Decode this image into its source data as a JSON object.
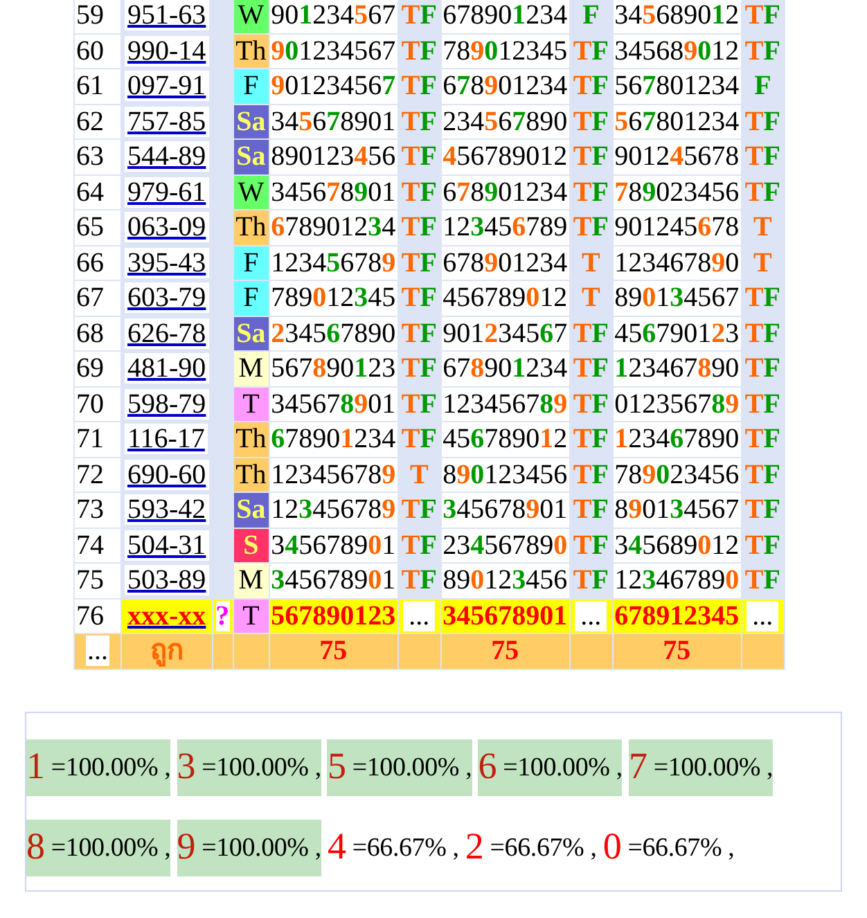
{
  "rows": [
    {
      "no": "59",
      "code": "951-63",
      "day": {
        "text": "W",
        "color": "#66ff66"
      },
      "cells": [
        {
          "kind": "number",
          "parts": [
            {
              "text": "90"
            },
            {
              "text": "1",
              "color": "#009900"
            },
            {
              "text": "234"
            },
            {
              "text": "5",
              "color": "#ff6600"
            },
            {
              "text": "67"
            }
          ]
        },
        {
          "kind": "result",
          "parts": [
            {
              "text": "T",
              "color": "#ff6600"
            },
            {
              "text": "F",
              "color": "#009900"
            }
          ]
        },
        {
          "kind": "number",
          "parts": [
            {
              "text": "67890"
            },
            {
              "text": "1",
              "color": "#009900"
            },
            {
              "text": "234"
            }
          ]
        },
        {
          "kind": "result",
          "parts": [
            {
              "text": "F",
              "color": "#009900"
            }
          ]
        },
        {
          "kind": "number",
          "parts": [
            {
              "text": "34"
            },
            {
              "text": "5",
              "color": "#ff6600"
            },
            {
              "text": "6890"
            },
            {
              "text": "1",
              "color": "#009900"
            },
            {
              "text": "2"
            }
          ]
        },
        {
          "kind": "result",
          "parts": [
            {
              "text": "T",
              "color": "#ff6600"
            },
            {
              "text": "F",
              "color": "#009900"
            }
          ]
        }
      ]
    },
    {
      "no": "60",
      "code": "990-14",
      "day": {
        "text": "Th",
        "color": "#ffcc66"
      },
      "cells": [
        {
          "kind": "number",
          "parts": [
            {
              "text": "9",
              "color": "#ff6600"
            },
            {
              "text": "0",
              "color": "#009900"
            },
            {
              "text": "1234567"
            }
          ]
        },
        {
          "kind": "result",
          "parts": [
            {
              "text": "T",
              "color": "#ff6600"
            },
            {
              "text": "F",
              "color": "#009900"
            }
          ]
        },
        {
          "kind": "number",
          "parts": [
            {
              "text": "78"
            },
            {
              "text": "9",
              "color": "#ff6600"
            },
            {
              "text": "0",
              "color": "#009900"
            },
            {
              "text": "12345"
            }
          ]
        },
        {
          "kind": "result",
          "parts": [
            {
              "text": "T",
              "color": "#ff6600"
            },
            {
              "text": "F",
              "color": "#009900"
            }
          ]
        },
        {
          "kind": "number",
          "parts": [
            {
              "text": "34568"
            },
            {
              "text": "9",
              "color": "#ff6600"
            },
            {
              "text": "0",
              "color": "#009900"
            },
            {
              "text": "12"
            }
          ]
        },
        {
          "kind": "result",
          "parts": [
            {
              "text": "T",
              "color": "#ff6600"
            },
            {
              "text": "F",
              "color": "#009900"
            }
          ]
        }
      ]
    },
    {
      "no": "61",
      "code": "097-91",
      "day": {
        "text": "F",
        "color": "#66ffff"
      },
      "cells": [
        {
          "kind": "number",
          "parts": [
            {
              "text": "9",
              "color": "#ff6600"
            },
            {
              "text": "0123456"
            },
            {
              "text": "7",
              "color": "#009900"
            }
          ]
        },
        {
          "kind": "result",
          "parts": [
            {
              "text": "T",
              "color": "#ff6600"
            },
            {
              "text": "F",
              "color": "#009900"
            }
          ]
        },
        {
          "kind": "number",
          "parts": [
            {
              "text": "6"
            },
            {
              "text": "7",
              "color": "#009900"
            },
            {
              "text": "8"
            },
            {
              "text": "9",
              "color": "#ff6600"
            },
            {
              "text": "01234"
            }
          ]
        },
        {
          "kind": "result",
          "parts": [
            {
              "text": "T",
              "color": "#ff6600"
            },
            {
              "text": "F",
              "color": "#009900"
            }
          ]
        },
        {
          "kind": "number",
          "parts": [
            {
              "text": "56"
            },
            {
              "text": "7",
              "color": "#009900"
            },
            {
              "text": "801234"
            }
          ]
        },
        {
          "kind": "result",
          "parts": [
            {
              "text": "F",
              "color": "#009900"
            }
          ]
        }
      ]
    },
    {
      "no": "62",
      "code": "757-85",
      "day": {
        "text": "Sa",
        "color": "#6666cc"
      },
      "cells": [
        {
          "kind": "number",
          "parts": [
            {
              "text": "34"
            },
            {
              "text": "5",
              "color": "#ff6600"
            },
            {
              "text": "6"
            },
            {
              "text": "7",
              "color": "#009900"
            },
            {
              "text": "8901"
            }
          ]
        },
        {
          "kind": "result",
          "parts": [
            {
              "text": "T",
              "color": "#ff6600"
            },
            {
              "text": "F",
              "color": "#009900"
            }
          ]
        },
        {
          "kind": "number",
          "parts": [
            {
              "text": "234"
            },
            {
              "text": "5",
              "color": "#ff6600"
            },
            {
              "text": "6"
            },
            {
              "text": "7",
              "color": "#009900"
            },
            {
              "text": "890"
            }
          ]
        },
        {
          "kind": "result",
          "parts": [
            {
              "text": "T",
              "color": "#ff6600"
            },
            {
              "text": "F",
              "color": "#009900"
            }
          ]
        },
        {
          "kind": "number",
          "parts": [
            {
              "text": "5",
              "color": "#ff6600"
            },
            {
              "text": "6"
            },
            {
              "text": "7",
              "color": "#009900"
            },
            {
              "text": "801234"
            }
          ]
        },
        {
          "kind": "result",
          "parts": [
            {
              "text": "T",
              "color": "#ff6600"
            },
            {
              "text": "F",
              "color": "#009900"
            }
          ]
        }
      ]
    },
    {
      "no": "63",
      "code": "544-89",
      "day": {
        "text": "Sa",
        "color": "#6666cc"
      },
      "cells": [
        {
          "kind": "number",
          "parts": [
            {
              "text": "890123"
            },
            {
              "text": "4",
              "color": "#ff6600"
            },
            {
              "text": "56"
            }
          ]
        },
        {
          "kind": "result",
          "parts": [
            {
              "text": "T",
              "color": "#ff6600"
            },
            {
              "text": "F",
              "color": "#009900"
            }
          ]
        },
        {
          "kind": "number",
          "parts": [
            {
              "text": "4",
              "color": "#ff6600"
            },
            {
              "text": "56789012"
            }
          ]
        },
        {
          "kind": "result",
          "parts": [
            {
              "text": "T",
              "color": "#ff6600"
            },
            {
              "text": "F",
              "color": "#009900"
            }
          ]
        },
        {
          "kind": "number",
          "parts": [
            {
              "text": "9012"
            },
            {
              "text": "4",
              "color": "#ff6600"
            },
            {
              "text": "5678"
            }
          ]
        },
        {
          "kind": "result",
          "parts": [
            {
              "text": "T",
              "color": "#ff6600"
            },
            {
              "text": "F",
              "color": "#009900"
            }
          ]
        }
      ]
    },
    {
      "no": "64",
      "code": "979-61",
      "day": {
        "text": "W",
        "color": "#66ff66"
      },
      "cells": [
        {
          "kind": "number",
          "parts": [
            {
              "text": "3456"
            },
            {
              "text": "7",
              "color": "#ff6600"
            },
            {
              "text": "8"
            },
            {
              "text": "9",
              "color": "#009900"
            },
            {
              "text": "01"
            }
          ]
        },
        {
          "kind": "result",
          "parts": [
            {
              "text": "T",
              "color": "#ff6600"
            },
            {
              "text": "F",
              "color": "#009900"
            }
          ]
        },
        {
          "kind": "number",
          "parts": [
            {
              "text": "6"
            },
            {
              "text": "7",
              "color": "#ff6600"
            },
            {
              "text": "8"
            },
            {
              "text": "9",
              "color": "#009900"
            },
            {
              "text": "01234"
            }
          ]
        },
        {
          "kind": "result",
          "parts": [
            {
              "text": "T",
              "color": "#ff6600"
            },
            {
              "text": "F",
              "color": "#009900"
            }
          ]
        },
        {
          "kind": "number",
          "parts": [
            {
              "text": "7",
              "color": "#ff6600"
            },
            {
              "text": "8"
            },
            {
              "text": "9",
              "color": "#009900"
            },
            {
              "text": "023456"
            }
          ]
        },
        {
          "kind": "result",
          "parts": [
            {
              "text": "T",
              "color": "#ff6600"
            },
            {
              "text": "F",
              "color": "#009900"
            }
          ]
        }
      ]
    },
    {
      "no": "65",
      "code": "063-09",
      "day": {
        "text": "Th",
        "color": "#ffcc66"
      },
      "cells": [
        {
          "kind": "number",
          "parts": [
            {
              "text": "6",
              "color": "#ff6600"
            },
            {
              "text": "789012"
            },
            {
              "text": "3",
              "color": "#009900"
            },
            {
              "text": "4"
            }
          ]
        },
        {
          "kind": "result",
          "parts": [
            {
              "text": "T",
              "color": "#ff6600"
            },
            {
              "text": "F",
              "color": "#009900"
            }
          ]
        },
        {
          "kind": "number",
          "parts": [
            {
              "text": "12"
            },
            {
              "text": "3",
              "color": "#009900"
            },
            {
              "text": "45"
            },
            {
              "text": "6",
              "color": "#ff6600"
            },
            {
              "text": "789"
            }
          ]
        },
        {
          "kind": "result",
          "parts": [
            {
              "text": "T",
              "color": "#ff6600"
            },
            {
              "text": "F",
              "color": "#009900"
            }
          ]
        },
        {
          "kind": "number",
          "parts": [
            {
              "text": "901245"
            },
            {
              "text": "6",
              "color": "#ff6600"
            },
            {
              "text": "78"
            }
          ]
        },
        {
          "kind": "result",
          "parts": [
            {
              "text": "T",
              "color": "#ff6600"
            }
          ]
        }
      ]
    },
    {
      "no": "66",
      "code": "395-43",
      "day": {
        "text": "F",
        "color": "#66ffff"
      },
      "cells": [
        {
          "kind": "number",
          "parts": [
            {
              "text": "1234"
            },
            {
              "text": "5",
              "color": "#009900"
            },
            {
              "text": "678"
            },
            {
              "text": "9",
              "color": "#ff6600"
            }
          ]
        },
        {
          "kind": "result",
          "parts": [
            {
              "text": "T",
              "color": "#ff6600"
            },
            {
              "text": "F",
              "color": "#009900"
            }
          ]
        },
        {
          "kind": "number",
          "parts": [
            {
              "text": "678"
            },
            {
              "text": "9",
              "color": "#ff6600"
            },
            {
              "text": "01234"
            }
          ]
        },
        {
          "kind": "result",
          "parts": [
            {
              "text": "T",
              "color": "#ff6600"
            }
          ]
        },
        {
          "kind": "number",
          "parts": [
            {
              "text": "1234678"
            },
            {
              "text": "9",
              "color": "#ff6600"
            },
            {
              "text": "0"
            }
          ]
        },
        {
          "kind": "result",
          "parts": [
            {
              "text": "T",
              "color": "#ff6600"
            }
          ]
        }
      ]
    },
    {
      "no": "67",
      "code": "603-79",
      "day": {
        "text": "F",
        "color": "#66ffff"
      },
      "cells": [
        {
          "kind": "number",
          "parts": [
            {
              "text": "789"
            },
            {
              "text": "0",
              "color": "#ff6600"
            },
            {
              "text": "12"
            },
            {
              "text": "3",
              "color": "#009900"
            },
            {
              "text": "45"
            }
          ]
        },
        {
          "kind": "result",
          "parts": [
            {
              "text": "T",
              "color": "#ff6600"
            },
            {
              "text": "F",
              "color": "#009900"
            }
          ]
        },
        {
          "kind": "number",
          "parts": [
            {
              "text": "456789"
            },
            {
              "text": "0",
              "color": "#ff6600"
            },
            {
              "text": "12"
            }
          ]
        },
        {
          "kind": "result",
          "parts": [
            {
              "text": "T",
              "color": "#ff6600"
            }
          ]
        },
        {
          "kind": "number",
          "parts": [
            {
              "text": "89"
            },
            {
              "text": "0",
              "color": "#ff6600"
            },
            {
              "text": "1"
            },
            {
              "text": "3",
              "color": "#009900"
            },
            {
              "text": "4567"
            }
          ]
        },
        {
          "kind": "result",
          "parts": [
            {
              "text": "T",
              "color": "#ff6600"
            },
            {
              "text": "F",
              "color": "#009900"
            }
          ]
        }
      ]
    },
    {
      "no": "68",
      "code": "626-78",
      "day": {
        "text": "Sa",
        "color": "#6666cc"
      },
      "cells": [
        {
          "kind": "number",
          "parts": [
            {
              "text": "2",
              "color": "#ff6600"
            },
            {
              "text": "345"
            },
            {
              "text": "6",
              "color": "#009900"
            },
            {
              "text": "7890"
            }
          ]
        },
        {
          "kind": "result",
          "parts": [
            {
              "text": "T",
              "color": "#ff6600"
            },
            {
              "text": "F",
              "color": "#009900"
            }
          ]
        },
        {
          "kind": "number",
          "parts": [
            {
              "text": "901"
            },
            {
              "text": "2",
              "color": "#ff6600"
            },
            {
              "text": "345"
            },
            {
              "text": "6",
              "color": "#009900"
            },
            {
              "text": "7"
            }
          ]
        },
        {
          "kind": "result",
          "parts": [
            {
              "text": "T",
              "color": "#ff6600"
            },
            {
              "text": "F",
              "color": "#009900"
            }
          ]
        },
        {
          "kind": "number",
          "parts": [
            {
              "text": "45"
            },
            {
              "text": "6",
              "color": "#009900"
            },
            {
              "text": "7901"
            },
            {
              "text": "2",
              "color": "#ff6600"
            },
            {
              "text": "3"
            }
          ]
        },
        {
          "kind": "result",
          "parts": [
            {
              "text": "T",
              "color": "#ff6600"
            },
            {
              "text": "F",
              "color": "#009900"
            }
          ]
        }
      ]
    },
    {
      "no": "69",
      "code": "481-90",
      "day": {
        "text": "M",
        "color": "#ffffcc"
      },
      "cells": [
        {
          "kind": "number",
          "parts": [
            {
              "text": "567"
            },
            {
              "text": "8",
              "color": "#ff6600"
            },
            {
              "text": "90"
            },
            {
              "text": "1",
              "color": "#009900"
            },
            {
              "text": "23"
            }
          ]
        },
        {
          "kind": "result",
          "parts": [
            {
              "text": "T",
              "color": "#ff6600"
            },
            {
              "text": "F",
              "color": "#009900"
            }
          ]
        },
        {
          "kind": "number",
          "parts": [
            {
              "text": "67"
            },
            {
              "text": "8",
              "color": "#ff6600"
            },
            {
              "text": "90"
            },
            {
              "text": "1",
              "color": "#009900"
            },
            {
              "text": "234"
            }
          ]
        },
        {
          "kind": "result",
          "parts": [
            {
              "text": "T",
              "color": "#ff6600"
            },
            {
              "text": "F",
              "color": "#009900"
            }
          ]
        },
        {
          "kind": "number",
          "parts": [
            {
              "text": "1",
              "color": "#009900"
            },
            {
              "text": "23467"
            },
            {
              "text": "8",
              "color": "#ff6600"
            },
            {
              "text": "90"
            }
          ]
        },
        {
          "kind": "result",
          "parts": [
            {
              "text": "T",
              "color": "#ff6600"
            },
            {
              "text": "F",
              "color": "#009900"
            }
          ]
        }
      ]
    },
    {
      "no": "70",
      "code": "598-79",
      "day": {
        "text": "T",
        "color": "#ff99ff"
      },
      "cells": [
        {
          "kind": "number",
          "parts": [
            {
              "text": "34567"
            },
            {
              "text": "8",
              "color": "#009900"
            },
            {
              "text": "9",
              "color": "#ff6600"
            },
            {
              "text": "01"
            }
          ]
        },
        {
          "kind": "result",
          "parts": [
            {
              "text": "T",
              "color": "#ff6600"
            },
            {
              "text": "F",
              "color": "#009900"
            }
          ]
        },
        {
          "kind": "number",
          "parts": [
            {
              "text": "1234567"
            },
            {
              "text": "8",
              "color": "#009900"
            },
            {
              "text": "9",
              "color": "#ff6600"
            }
          ]
        },
        {
          "kind": "result",
          "parts": [
            {
              "text": "T",
              "color": "#ff6600"
            },
            {
              "text": "F",
              "color": "#009900"
            }
          ]
        },
        {
          "kind": "number",
          "parts": [
            {
              "text": "0123567"
            },
            {
              "text": "8",
              "color": "#009900"
            },
            {
              "text": "9",
              "color": "#ff6600"
            }
          ]
        },
        {
          "kind": "result",
          "parts": [
            {
              "text": "T",
              "color": "#ff6600"
            },
            {
              "text": "F",
              "color": "#009900"
            }
          ]
        }
      ]
    },
    {
      "no": "71",
      "code": "116-17",
      "day": {
        "text": "Th",
        "color": "#ffcc66"
      },
      "cells": [
        {
          "kind": "number",
          "parts": [
            {
              "text": "6",
              "color": "#009900"
            },
            {
              "text": "7890"
            },
            {
              "text": "1",
              "color": "#ff6600"
            },
            {
              "text": "234"
            }
          ]
        },
        {
          "kind": "result",
          "parts": [
            {
              "text": "T",
              "color": "#ff6600"
            },
            {
              "text": "F",
              "color": "#009900"
            }
          ]
        },
        {
          "kind": "number",
          "parts": [
            {
              "text": "45"
            },
            {
              "text": "6",
              "color": "#009900"
            },
            {
              "text": "7890"
            },
            {
              "text": "1",
              "color": "#ff6600"
            },
            {
              "text": "2"
            }
          ]
        },
        {
          "kind": "result",
          "parts": [
            {
              "text": "T",
              "color": "#ff6600"
            },
            {
              "text": "F",
              "color": "#009900"
            }
          ]
        },
        {
          "kind": "number",
          "parts": [
            {
              "text": "1",
              "color": "#ff6600"
            },
            {
              "text": "234"
            },
            {
              "text": "6",
              "color": "#009900"
            },
            {
              "text": "7890"
            }
          ]
        },
        {
          "kind": "result",
          "parts": [
            {
              "text": "T",
              "color": "#ff6600"
            },
            {
              "text": "F",
              "color": "#009900"
            }
          ]
        }
      ]
    },
    {
      "no": "72",
      "code": "690-60",
      "day": {
        "text": "Th",
        "color": "#ffcc66"
      },
      "cells": [
        {
          "kind": "number",
          "parts": [
            {
              "text": "12345678"
            },
            {
              "text": "9",
              "color": "#ff6600"
            }
          ]
        },
        {
          "kind": "result",
          "parts": [
            {
              "text": "T",
              "color": "#ff6600"
            }
          ]
        },
        {
          "kind": "number",
          "parts": [
            {
              "text": "8"
            },
            {
              "text": "9",
              "color": "#ff6600"
            },
            {
              "text": "0",
              "color": "#009900"
            },
            {
              "text": "123456"
            }
          ]
        },
        {
          "kind": "result",
          "parts": [
            {
              "text": "T",
              "color": "#ff6600"
            },
            {
              "text": "F",
              "color": "#009900"
            }
          ]
        },
        {
          "kind": "number",
          "parts": [
            {
              "text": "78"
            },
            {
              "text": "9",
              "color": "#ff6600"
            },
            {
              "text": "0",
              "color": "#009900"
            },
            {
              "text": "23456"
            }
          ]
        },
        {
          "kind": "result",
          "parts": [
            {
              "text": "T",
              "color": "#ff6600"
            },
            {
              "text": "F",
              "color": "#009900"
            }
          ]
        }
      ]
    },
    {
      "no": "73",
      "code": "593-42",
      "day": {
        "text": "Sa",
        "color": "#6666cc"
      },
      "cells": [
        {
          "kind": "number",
          "parts": [
            {
              "text": "12"
            },
            {
              "text": "3",
              "color": "#009900"
            },
            {
              "text": "45678"
            },
            {
              "text": "9",
              "color": "#ff6600"
            }
          ]
        },
        {
          "kind": "result",
          "parts": [
            {
              "text": "T",
              "color": "#ff6600"
            },
            {
              "text": "F",
              "color": "#009900"
            }
          ]
        },
        {
          "kind": "number",
          "parts": [
            {
              "text": "3",
              "color": "#009900"
            },
            {
              "text": "45678"
            },
            {
              "text": "9",
              "color": "#ff6600"
            },
            {
              "text": "01"
            }
          ]
        },
        {
          "kind": "result",
          "parts": [
            {
              "text": "T",
              "color": "#ff6600"
            },
            {
              "text": "F",
              "color": "#009900"
            }
          ]
        },
        {
          "kind": "number",
          "parts": [
            {
              "text": "8"
            },
            {
              "text": "9",
              "color": "#ff6600"
            },
            {
              "text": "01"
            },
            {
              "text": "3",
              "color": "#009900"
            },
            {
              "text": "4567"
            }
          ]
        },
        {
          "kind": "result",
          "parts": [
            {
              "text": "T",
              "color": "#ff6600"
            },
            {
              "text": "F",
              "color": "#009900"
            }
          ]
        }
      ]
    },
    {
      "no": "74",
      "code": "504-31",
      "day": {
        "text": "S",
        "color": "#ff3366"
      },
      "cells": [
        {
          "kind": "number",
          "parts": [
            {
              "text": "3"
            },
            {
              "text": "4",
              "color": "#009900"
            },
            {
              "text": "56789"
            },
            {
              "text": "0",
              "color": "#ff6600"
            },
            {
              "text": "1"
            }
          ]
        },
        {
          "kind": "result",
          "parts": [
            {
              "text": "T",
              "color": "#ff6600"
            },
            {
              "text": "F",
              "color": "#009900"
            }
          ]
        },
        {
          "kind": "number",
          "parts": [
            {
              "text": "23"
            },
            {
              "text": "4",
              "color": "#009900"
            },
            {
              "text": "56789"
            },
            {
              "text": "0",
              "color": "#ff6600"
            }
          ]
        },
        {
          "kind": "result",
          "parts": [
            {
              "text": "T",
              "color": "#ff6600"
            },
            {
              "text": "F",
              "color": "#009900"
            }
          ]
        },
        {
          "kind": "number",
          "parts": [
            {
              "text": "3"
            },
            {
              "text": "4",
              "color": "#009900"
            },
            {
              "text": "5689"
            },
            {
              "text": "0",
              "color": "#ff6600"
            },
            {
              "text": "12"
            }
          ]
        },
        {
          "kind": "result",
          "parts": [
            {
              "text": "T",
              "color": "#ff6600"
            },
            {
              "text": "F",
              "color": "#009900"
            }
          ]
        }
      ]
    },
    {
      "no": "75",
      "code": "503-89",
      "day": {
        "text": "M",
        "color": "#ffffcc"
      },
      "cells": [
        {
          "kind": "number",
          "parts": [
            {
              "text": "3",
              "color": "#009900"
            },
            {
              "text": "456789"
            },
            {
              "text": "0",
              "color": "#ff6600"
            },
            {
              "text": "1"
            }
          ]
        },
        {
          "kind": "result",
          "parts": [
            {
              "text": "T",
              "color": "#ff6600"
            },
            {
              "text": "F",
              "color": "#009900"
            }
          ]
        },
        {
          "kind": "number",
          "parts": [
            {
              "text": "89"
            },
            {
              "text": "0",
              "color": "#ff6600"
            },
            {
              "text": "12"
            },
            {
              "text": "3",
              "color": "#009900"
            },
            {
              "text": "456"
            }
          ]
        },
        {
          "kind": "result",
          "parts": [
            {
              "text": "T",
              "color": "#ff6600"
            },
            {
              "text": "F",
              "color": "#009900"
            }
          ]
        },
        {
          "kind": "number",
          "parts": [
            {
              "text": "12"
            },
            {
              "text": "3",
              "color": "#009900"
            },
            {
              "text": "46789"
            },
            {
              "text": "0",
              "color": "#ff6600"
            }
          ]
        },
        {
          "kind": "result",
          "parts": [
            {
              "text": "T",
              "color": "#ff6600"
            },
            {
              "text": "F",
              "color": "#009900"
            }
          ]
        }
      ]
    },
    {
      "no": "76",
      "code": "xxx-xx",
      "current": true,
      "flag": "?",
      "day": {
        "text": "T",
        "color": "#ff99ff"
      },
      "cells": [
        {
          "kind": "number",
          "parts": [
            {
              "text": "567890123"
            }
          ]
        },
        {
          "kind": "result",
          "parts": [
            {
              "text": "..."
            }
          ]
        },
        {
          "kind": "number",
          "parts": [
            {
              "text": "345678901"
            }
          ]
        },
        {
          "kind": "result",
          "parts": [
            {
              "text": "..."
            }
          ]
        },
        {
          "kind": "number",
          "parts": [
            {
              "text": "678912345"
            }
          ]
        },
        {
          "kind": "result",
          "parts": [
            {
              "text": "..."
            }
          ]
        }
      ]
    }
  ],
  "footer": {
    "more": "...",
    "label": "ถูก",
    "counts": [
      "75",
      "75",
      "75"
    ]
  },
  "summary": [
    {
      "digit": "1",
      "value": "=100.00% ,",
      "hit": true
    },
    {
      "digit": "3",
      "value": "=100.00% ,",
      "hit": true
    },
    {
      "digit": "5",
      "value": "=100.00% ,",
      "hit": true
    },
    {
      "digit": "6",
      "value": "=100.00% ,",
      "hit": true
    },
    {
      "digit": "7",
      "value": "=100.00% ,",
      "hit": true
    },
    {
      "digit": "8",
      "value": "=100.00% ,",
      "hit": true
    },
    {
      "digit": "9",
      "value": "=100.00% ,",
      "hit": true
    },
    {
      "digit": "4",
      "value": "=66.67% ,",
      "hit": false
    },
    {
      "digit": "2",
      "value": "=66.67% ,",
      "hit": false
    },
    {
      "digit": "0",
      "value": "=66.67% ,",
      "hit": false
    }
  ]
}
